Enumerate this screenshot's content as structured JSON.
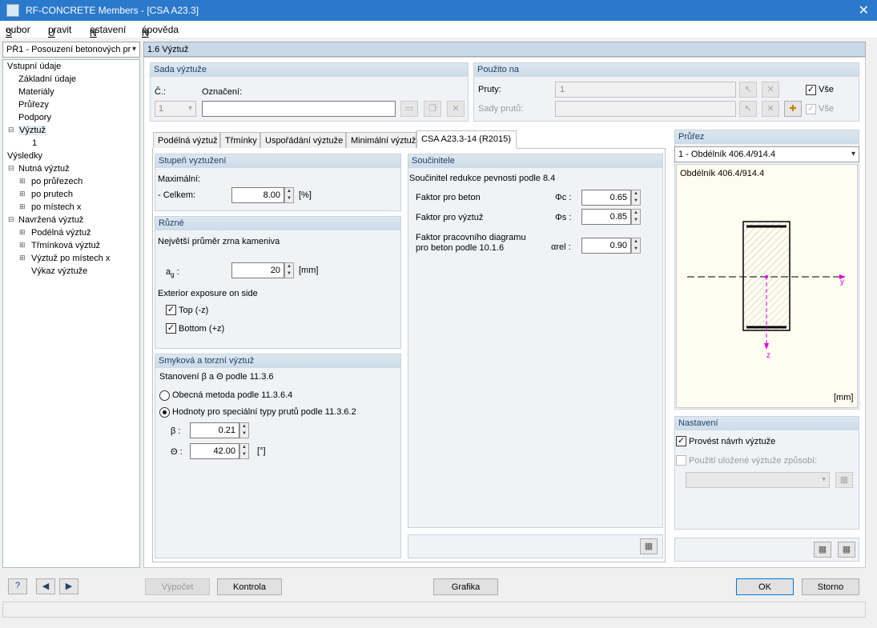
{
  "window": {
    "title": "RF-CONCRETE Members - [CSA A23.3]"
  },
  "menu": {
    "items": [
      {
        "label": "Soubor",
        "ul": "S"
      },
      {
        "label": "Upravit",
        "ul": "U"
      },
      {
        "label": "Nastavení",
        "ul": "N"
      },
      {
        "label": "Nápověda",
        "ul": "N"
      }
    ]
  },
  "case_select": {
    "value": "PŘ1 - Posouzení betonových pr"
  },
  "nav": {
    "input_data": "Vstupní údaje",
    "basic": "Základní údaje",
    "materials": "Materiály",
    "sections": "Průřezy",
    "supports": "Podpory",
    "reinforcement": "Výztuž",
    "rebar_set": "1",
    "results": "Výsledky",
    "required": "Nutná výztuž",
    "by_section": "po průřezech",
    "by_member": "po prutech",
    "by_x": "po místech x",
    "provided": "Navržená výztuž",
    "longitudinal": "Podélná výztuž",
    "stirrup": "Třmínková výztuž",
    "by_x2": "Výztuž po místech x",
    "bom": "Výkaz výztuže"
  },
  "page": {
    "title": "1.6 Výztuž"
  },
  "rebar_set": {
    "header": "Sada výztuže",
    "no_label": "Č.:",
    "no_value": "1",
    "name_label": "Označení:",
    "name_value": ""
  },
  "applied": {
    "header": "Použito na",
    "members_label": "Pruty:",
    "members_value": "1",
    "all_label": "Vše",
    "sets_label": "Sady prutů:",
    "sets_value": "",
    "all2_label": "Vše"
  },
  "tabs": [
    {
      "label": "Podélná výztuž"
    },
    {
      "label": "Třmínky"
    },
    {
      "label": "Uspořádání výztuže"
    },
    {
      "label": "Minimální výztuž"
    },
    {
      "label": "CSA A23.3-14 (R2015)"
    }
  ],
  "ratio": {
    "header": "Stupeň vyztužení",
    "max_label": "Maximální:",
    "total_label": "- Celkem:",
    "total_value": "8.00",
    "unit": "[%]"
  },
  "misc": {
    "header": "Různé",
    "agg_label": "Největší průměr zrna kameniva",
    "ag_label": "a",
    "ag_sub": "g",
    "ag_colon": ":",
    "ag_value": "20",
    "ag_unit": "[mm]",
    "exposure_label": "Exterior exposure on side",
    "top_label": "Top (-z)",
    "bottom_label": "Bottom (+z)"
  },
  "shear": {
    "header": "Smyková a torzní výztuž",
    "determ_label": "Stanovení β a Θ podle 11.3.6",
    "general_label": "Obecná metoda podle 11.3.6.4",
    "special_label": "Hodnoty pro speciální typy prutů podle 11.3.6.2",
    "beta_label": "β :",
    "beta_value": "0.21",
    "theta_label": "Θ :",
    "theta_value": "42.00",
    "theta_unit": "[°]"
  },
  "factors": {
    "header": "Součinitele",
    "title": "Součinitel redukce pevnosti podle 8.4",
    "concrete_label": "Faktor pro beton",
    "concrete_sym": "Φc :",
    "concrete_value": "0.65",
    "steel_label": "Faktor pro výztuž",
    "steel_sym": "Φs :",
    "steel_value": "0.85",
    "diagram_label1": "Faktor pracovního diagramu",
    "diagram_label2": "pro beton podle 10.1.6",
    "diagram_sym": "αrel :",
    "diagram_value": "0.90"
  },
  "section": {
    "header": "Průřez",
    "select": "1 - Obdélník 406.4/914.4",
    "name": "Obdélník 406.4/914.4",
    "axis_y": "y",
    "axis_z": "z",
    "unit": "[mm]"
  },
  "settings": {
    "header": "Nastavení",
    "design_label": "Provést návrh výztuže",
    "stored_label": "Použití uložené výztuže způsobí:"
  },
  "buttons": {
    "calc": "Výpočet",
    "check": "Kontrola",
    "graphics": "Grafika",
    "ok": "OK",
    "cancel": "Storno"
  },
  "icons": {
    "help": "help-icon",
    "prev": "previous-icon",
    "next": "next-icon"
  }
}
